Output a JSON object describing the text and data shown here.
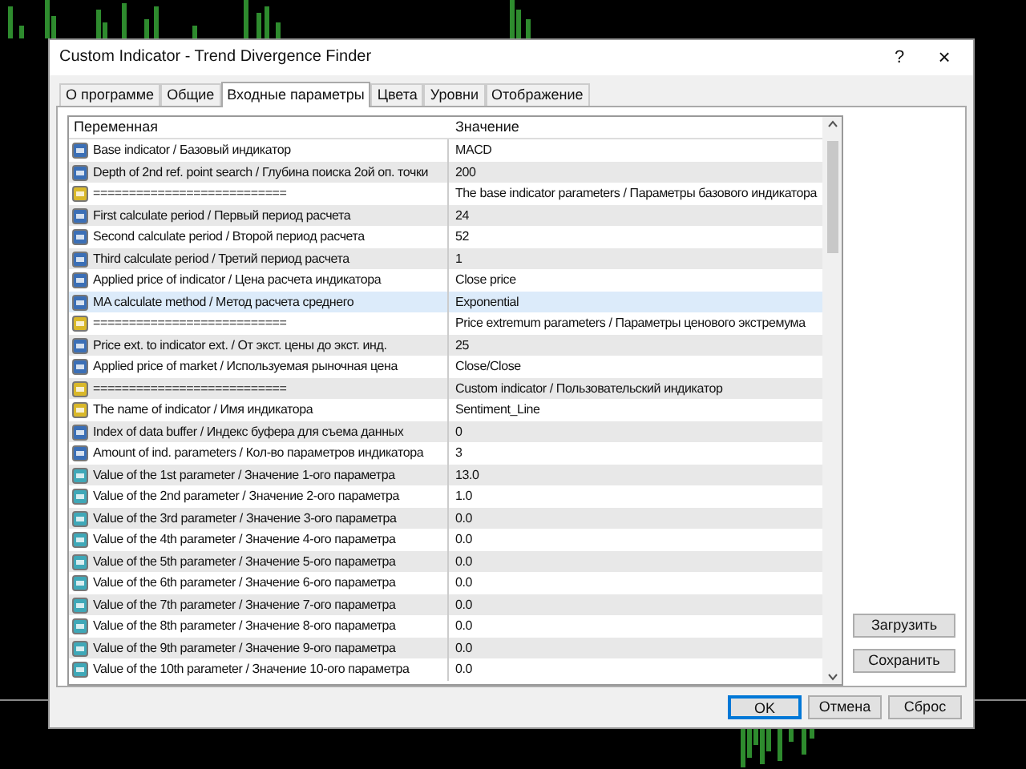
{
  "window": {
    "title": "Custom Indicator - Trend Divergence Finder",
    "help": "?",
    "close": "×"
  },
  "tabs": [
    {
      "label": "О программе",
      "selected": false
    },
    {
      "label": "Общие",
      "selected": false
    },
    {
      "label": "Входные параметры",
      "selected": true
    },
    {
      "label": "Цвета",
      "selected": false
    },
    {
      "label": "Уровни",
      "selected": false
    },
    {
      "label": "Отображение",
      "selected": false
    }
  ],
  "table": {
    "columns": [
      "Переменная",
      "Значение"
    ],
    "rows": [
      {
        "kind": "int",
        "name": "Base indicator / Базовый индикатор",
        "value": "MACD",
        "selected": false
      },
      {
        "kind": "int",
        "name": "Depth of 2nd ref. point search / Глубина поиска 2ой оп. точки",
        "value": "200",
        "selected": false
      },
      {
        "kind": "string",
        "name": "===========================",
        "value": "The base indicator parameters / Параметры базового индикатора",
        "selected": false
      },
      {
        "kind": "int",
        "name": "First calculate period / Первый период расчета",
        "value": "24",
        "selected": false
      },
      {
        "kind": "int",
        "name": "Second calculate period / Второй период расчета",
        "value": "52",
        "selected": false
      },
      {
        "kind": "int",
        "name": "Third calculate period / Третий период расчета",
        "value": "1",
        "selected": false
      },
      {
        "kind": "int",
        "name": "Applied price of indicator / Цена расчета индикатора",
        "value": "Close price",
        "selected": false
      },
      {
        "kind": "int",
        "name": "MA calculate method / Метод расчета среднего",
        "value": "Exponential",
        "selected": true
      },
      {
        "kind": "string",
        "name": "===========================",
        "value": "Price extremum parameters / Параметры ценового экстремума",
        "selected": false
      },
      {
        "kind": "int",
        "name": "Price ext. to indicator ext. / От экст. цены до экст. инд.",
        "value": "25",
        "selected": false
      },
      {
        "kind": "int",
        "name": "Applied price of market / Используемая рыночная цена",
        "value": "Close/Close",
        "selected": false
      },
      {
        "kind": "string",
        "name": "===========================",
        "value": "Custom indicator / Пользовательский индикатор",
        "selected": false
      },
      {
        "kind": "string",
        "name": "The name of indicator / Имя индикатора",
        "value": "Sentiment_Line",
        "selected": false
      },
      {
        "kind": "int",
        "name": "Index of data buffer / Индекс буфера для съема данных",
        "value": "0",
        "selected": false
      },
      {
        "kind": "int",
        "name": "Amount of ind. parameters / Кол-во параметров индикатора",
        "value": "3",
        "selected": false
      },
      {
        "kind": "double",
        "name": "Value of the 1st parameter / Значение 1-ого параметра",
        "value": "13.0",
        "selected": false
      },
      {
        "kind": "double",
        "name": "Value of the 2nd parameter / Значение 2-ого параметра",
        "value": "1.0",
        "selected": false
      },
      {
        "kind": "double",
        "name": "Value of the 3rd parameter / Значение 3-ого параметра",
        "value": "0.0",
        "selected": false
      },
      {
        "kind": "double",
        "name": "Value of the 4th parameter / Значение 4-ого параметра",
        "value": "0.0",
        "selected": false
      },
      {
        "kind": "double",
        "name": "Value of the 5th parameter / Значение 5-ого параметра",
        "value": "0.0",
        "selected": false
      },
      {
        "kind": "double",
        "name": "Value of the 6th parameter / Значение 6-ого параметра",
        "value": "0.0",
        "selected": false
      },
      {
        "kind": "double",
        "name": "Value of the 7th parameter / Значение 7-ого параметра",
        "value": "0.0",
        "selected": false
      },
      {
        "kind": "double",
        "name": "Value of the 8th parameter / Значение 8-ого параметра",
        "value": "0.0",
        "selected": false
      },
      {
        "kind": "double",
        "name": "Value of the 9th parameter / Значение 9-ого параметра",
        "value": "0.0",
        "selected": false
      },
      {
        "kind": "double",
        "name": "Value of the 10th parameter / Значение 10-ого параметра",
        "value": "0.0",
        "selected": false
      }
    ]
  },
  "side_buttons": [
    "Загрузить",
    "Сохранить"
  ],
  "buttons": [
    {
      "label": "OK",
      "selected": true
    },
    {
      "label": "Отмена",
      "selected": false
    },
    {
      "label": "Сброс",
      "selected": false
    }
  ]
}
